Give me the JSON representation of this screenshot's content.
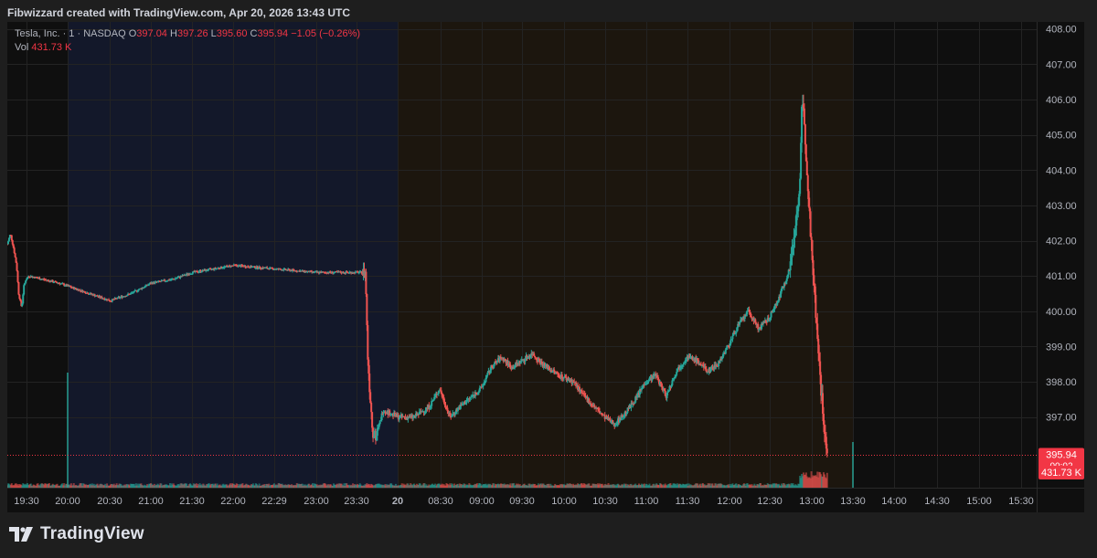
{
  "header": {
    "title": "Fibwizzard created with TradingView.com, Apr 20, 2026 13:43 UTC"
  },
  "legend": {
    "symbol": "Tesla, Inc. · 1 · NASDAQ",
    "o_label": "O",
    "o_value": "397.04",
    "h_label": "H",
    "h_value": "397.26",
    "l_label": "L",
    "l_value": "395.60",
    "c_label": "C",
    "c_value": "395.94",
    "change": "−1.05 (−0.26%)",
    "vol_label": "Vol",
    "vol_value": "431.73 K"
  },
  "price_tag": {
    "price": "395.94",
    "countdown": "00:02"
  },
  "volume_tag": "431.73 K",
  "footer": {
    "brand": "TradingView"
  },
  "colors": {
    "up": "#26a69a",
    "down": "#ef5350",
    "premarket_bg": "#13182a",
    "regular_bg": "#1c160e",
    "tag": "#f23645"
  },
  "chart_data": {
    "type": "candlestick",
    "symbol": "Tesla, Inc.",
    "interval": "1",
    "exchange": "NASDAQ",
    "ylim": [
      395.0,
      408.2
    ],
    "y_ticks": [
      "397.00",
      "398.00",
      "399.00",
      "400.00",
      "401.00",
      "402.00",
      "403.00",
      "404.00",
      "405.00",
      "406.00",
      "407.00",
      "408.00"
    ],
    "x_ticks": [
      "19:30",
      "20:00",
      "20:30",
      "21:00",
      "21:30",
      "22:00",
      "22:29",
      "23:00",
      "23:30",
      "20",
      "08:30",
      "09:00",
      "09:30",
      "10:00",
      "10:30",
      "11:00",
      "11:30",
      "12:00",
      "12:30",
      "13:00",
      "13:30",
      "14:00",
      "14:30",
      "15:00",
      "15:30"
    ],
    "x_tick_bold": [
      false,
      false,
      false,
      false,
      false,
      false,
      false,
      false,
      false,
      true,
      false,
      false,
      false,
      false,
      false,
      false,
      false,
      false,
      false,
      false,
      false,
      false,
      false,
      false,
      false
    ],
    "sessions": [
      {
        "name": "premarket",
        "from": "20:00",
        "to": "08:00"
      },
      {
        "name": "regular",
        "from": "08:00",
        "to": "13:30"
      }
    ],
    "price_path": [
      [
        0,
        401.9
      ],
      [
        0.03,
        402.2
      ],
      [
        0.06,
        401.8
      ],
      [
        0.09,
        401.3
      ],
      [
        0.11,
        400.5
      ],
      [
        0.14,
        400.1
      ],
      [
        0.16,
        400.7
      ],
      [
        0.18,
        400.9
      ],
      [
        0.21,
        401.0
      ],
      [
        0.5,
        400.8
      ],
      [
        0.8,
        400.5
      ],
      [
        1.0,
        400.3
      ],
      [
        1.2,
        400.5
      ],
      [
        1.4,
        400.8
      ],
      [
        1.6,
        400.9
      ],
      [
        1.8,
        401.1
      ],
      [
        2.2,
        401.3
      ],
      [
        2.6,
        401.2
      ],
      [
        3.0,
        401.1
      ],
      [
        3.3,
        401.1
      ],
      [
        3.48,
        401.1
      ],
      [
        3.5,
        398.8
      ],
      [
        3.52,
        397.8
      ],
      [
        3.55,
        396.6
      ],
      [
        3.58,
        396.4
      ],
      [
        3.65,
        397.2
      ],
      [
        3.8,
        397.0
      ],
      [
        3.95,
        397.0
      ],
      [
        4.1,
        397.3
      ],
      [
        4.2,
        397.8
      ],
      [
        4.3,
        397.0
      ],
      [
        4.4,
        397.3
      ],
      [
        4.6,
        397.8
      ],
      [
        4.7,
        398.4
      ],
      [
        4.8,
        398.7
      ],
      [
        4.9,
        398.4
      ],
      [
        5.0,
        398.6
      ],
      [
        5.1,
        398.8
      ],
      [
        5.2,
        398.5
      ],
      [
        5.35,
        398.2
      ],
      [
        5.5,
        398.0
      ],
      [
        5.6,
        397.6
      ],
      [
        5.7,
        397.3
      ],
      [
        5.8,
        397.0
      ],
      [
        5.9,
        396.8
      ],
      [
        6.0,
        397.1
      ],
      [
        6.1,
        397.5
      ],
      [
        6.2,
        398.0
      ],
      [
        6.3,
        398.2
      ],
      [
        6.4,
        397.6
      ],
      [
        6.5,
        398.3
      ],
      [
        6.6,
        398.7
      ],
      [
        6.7,
        398.6
      ],
      [
        6.8,
        398.3
      ],
      [
        6.9,
        398.5
      ],
      [
        7.0,
        399.0
      ],
      [
        7.1,
        399.6
      ],
      [
        7.2,
        400.0
      ],
      [
        7.3,
        399.5
      ],
      [
        7.4,
        399.8
      ],
      [
        7.5,
        400.4
      ],
      [
        7.6,
        401.2
      ],
      [
        7.65,
        402.3
      ],
      [
        7.7,
        403.6
      ],
      [
        7.72,
        406.2
      ],
      [
        7.75,
        405.0
      ],
      [
        7.78,
        403.5
      ],
      [
        7.82,
        401.4
      ],
      [
        7.86,
        399.7
      ],
      [
        7.9,
        398.0
      ],
      [
        7.94,
        396.5
      ],
      [
        7.97,
        395.9
      ]
    ],
    "x_domain": [
      0,
      10
    ],
    "last_price": 395.94,
    "last_volume": "431.73 K"
  }
}
